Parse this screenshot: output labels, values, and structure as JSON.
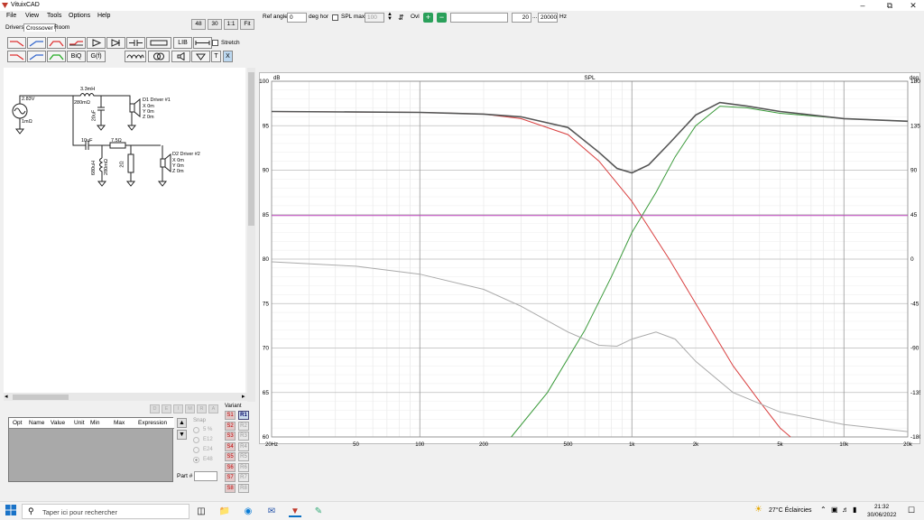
{
  "window": {
    "title": "VituixCAD"
  },
  "menu": [
    "File",
    "View",
    "Tools",
    "Options",
    "Help"
  ],
  "tabs": [
    "Drivers",
    "Crossover",
    "Room"
  ],
  "zoom_buttons": [
    "48",
    "30",
    "1:1",
    "Fit"
  ],
  "toolbar": {
    "lib": "LIB",
    "biq": "BiQ",
    "gf": "G(f)",
    "t": "T",
    "x": "X",
    "stretch_label": "Stretch"
  },
  "schematic": {
    "source_voltage": "2.83V",
    "source_impedance": "1mΩ",
    "l1": "3.3mH",
    "l1_res": "280mΩ",
    "c1": "20uF",
    "c2": "10uF",
    "l2": "680uH",
    "l2_res": "280mΩ",
    "r1": "7.5Ω",
    "r2": "2Ω",
    "driver1": {
      "name": "D1 Driver #1",
      "x": "X 0m",
      "y": "Y 0m",
      "z": "Z 0m"
    },
    "driver2": {
      "name": "D2 Driver #2",
      "x": "X 0m",
      "y": "Y 0m",
      "z": "Z 0m"
    }
  },
  "param_table": {
    "columns": [
      "Opt",
      "Name",
      "Value",
      "Unit",
      "Min",
      "Max",
      "Expression"
    ],
    "buttons": [
      "D",
      "E",
      "I",
      "M",
      "R",
      "A"
    ]
  },
  "snap": {
    "label": "Snap",
    "options": [
      "5 %",
      "E12",
      "E24",
      "E48"
    ]
  },
  "part_label": "Part #",
  "variant": {
    "label": "Variant",
    "s": [
      "S1",
      "S2",
      "S3",
      "S4",
      "S5",
      "S6",
      "S7",
      "S8"
    ],
    "r": [
      "R1",
      "R2",
      "R3",
      "R4",
      "R5",
      "R6",
      "R7",
      "R8"
    ]
  },
  "graph_toolbar": {
    "ref_angle_label": "Ref angle",
    "ref_angle_value": "0",
    "deg_hor": "deg hor",
    "spl_max_label": "SPL max",
    "spl_max_value": "100",
    "ovl_label": "Ovl",
    "freq_min": "20",
    "freq_sep": "...",
    "freq_max": "20000",
    "hz": "Hz"
  },
  "chart_data": {
    "type": "line",
    "title": "SPL",
    "y_unit_left": "dB",
    "y_unit_right": "deg",
    "x_scale": "log",
    "xlim": [
      20,
      20000
    ],
    "ylim": [
      60,
      100
    ],
    "y2lim": [
      -180,
      180
    ],
    "x_ticks": [
      "20Hz",
      "50",
      "100",
      "200",
      "500",
      "1k",
      "2k",
      "5k",
      "10k",
      "20k"
    ],
    "y_ticks": [
      "100",
      "95",
      "90",
      "85",
      "80",
      "75",
      "70",
      "65",
      "60"
    ],
    "y2_ticks": [
      "180",
      "135",
      "90",
      "45",
      "0",
      "-45",
      "-90",
      "-135",
      "-180"
    ],
    "grid": true,
    "series": [
      {
        "color": "#d94040",
        "x": [
          20,
          100,
          200,
          300,
          500,
          700,
          1000,
          1500,
          2000,
          3000,
          4000,
          5000,
          5600
        ],
        "y": [
          96.6,
          96.5,
          96.3,
          95.8,
          94.0,
          91.0,
          86.5,
          80.0,
          75.0,
          68.0,
          64.0,
          61.0,
          60
        ]
      },
      {
        "color": "#3a9a3a",
        "x": [
          270,
          400,
          600,
          800,
          1000,
          1300,
          1600,
          2000,
          2600,
          3500,
          5000,
          10000,
          20000
        ],
        "y": [
          60,
          65.0,
          72.0,
          78.0,
          83.0,
          87.5,
          91.5,
          95.0,
          97.2,
          97.0,
          96.4,
          95.8,
          95.5
        ]
      },
      {
        "color": "#555555",
        "x": [
          20,
          100,
          200,
          300,
          500,
          700,
          850,
          1000,
          1200,
          1500,
          2000,
          2600,
          3500,
          5000,
          10000,
          20000
        ],
        "y": [
          96.6,
          96.5,
          96.3,
          96.0,
          94.8,
          92.0,
          90.2,
          89.7,
          90.6,
          93.0,
          96.2,
          97.6,
          97.2,
          96.6,
          95.8,
          95.5
        ]
      },
      {
        "color": "#bb44bb",
        "x": [
          20,
          20000
        ],
        "y": [
          84.9,
          84.9
        ]
      },
      {
        "color": "#aaaaaa",
        "x": [
          20,
          50,
          100,
          200,
          300,
          500,
          700,
          850,
          1000,
          1300,
          1600,
          2000,
          3000,
          5000,
          10000,
          20000
        ],
        "y": [
          79.7,
          79.2,
          78.3,
          76.6,
          74.7,
          71.8,
          70.3,
          70.2,
          71.0,
          71.8,
          71.0,
          68.5,
          65.0,
          62.8,
          61.4,
          60.6
        ]
      }
    ]
  },
  "taskbar": {
    "search_placeholder": "Taper ici pour rechercher",
    "weather": "27°C  Éclaircies",
    "time": "21:32",
    "date": "30/06/2022"
  }
}
